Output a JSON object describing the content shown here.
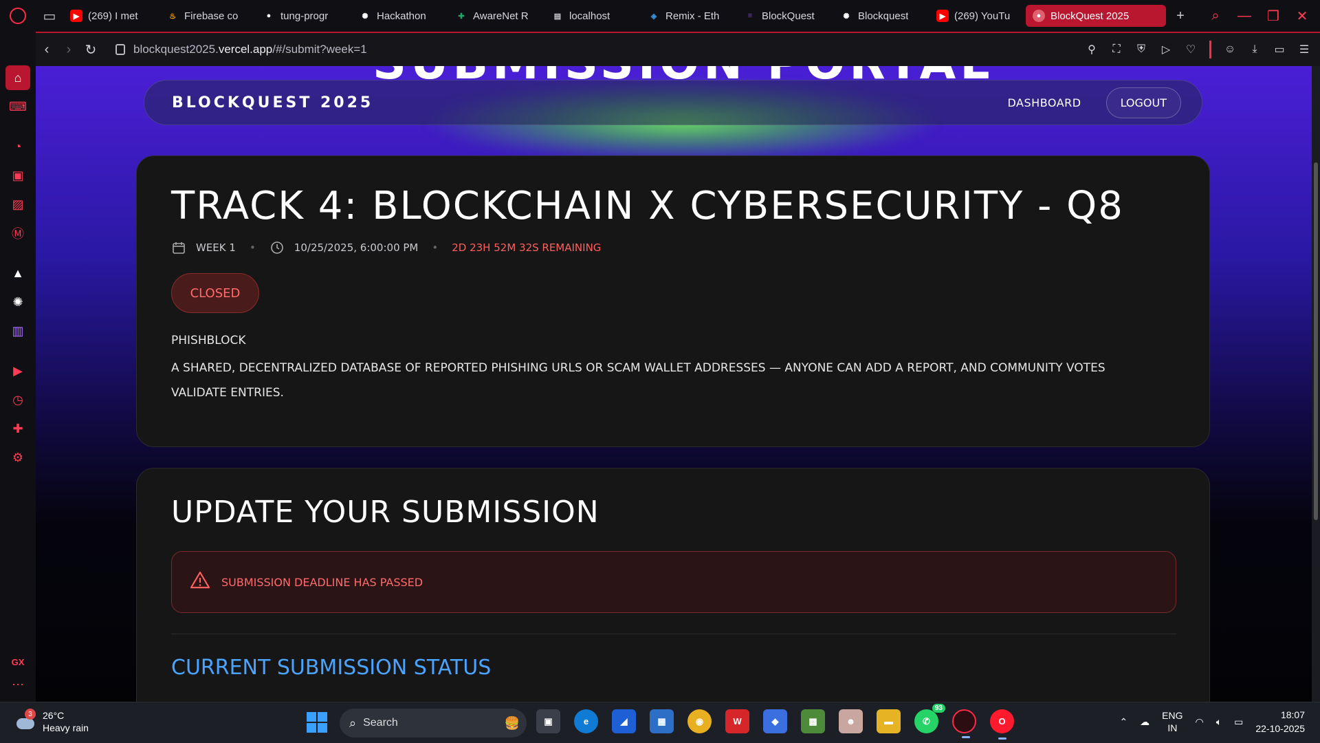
{
  "browser": {
    "tabs": [
      {
        "label": "(269) I met",
        "icon": "youtube-icon",
        "color": "#ff0000"
      },
      {
        "label": "Firebase co",
        "icon": "firebase-icon",
        "color": "#ffa000"
      },
      {
        "label": "tung-progr",
        "icon": "github-icon",
        "color": "#ffffff"
      },
      {
        "label": "Hackathon",
        "icon": "chatgpt-icon",
        "color": "#ffffff"
      },
      {
        "label": "AwareNet R",
        "icon": "sheets-icon",
        "color": "#22a565"
      },
      {
        "label": "localhost",
        "icon": "document-icon",
        "color": "#c8c8d0"
      },
      {
        "label": "Remix - Eth",
        "icon": "remix-icon",
        "color": "#3b8ed4"
      },
      {
        "label": "BlockQuest",
        "icon": "forms-icon",
        "color": "#7248b9"
      },
      {
        "label": "Blockquest",
        "icon": "chatgpt-icon",
        "color": "#ffffff"
      },
      {
        "label": "(269) YouTu",
        "icon": "youtube-icon",
        "color": "#ff0000"
      }
    ],
    "active_tab": {
      "label": "BlockQuest 2025",
      "icon": "site-icon"
    },
    "url_prefix": "blockquest2025.",
    "url_domain": "vercel.app",
    "url_path": "/#/submit?week=1"
  },
  "site": {
    "hero_title": "SUBMISSION PORTAL",
    "brand": "BLOCKQUEST 2025",
    "nav": {
      "dashboard": "DASHBOARD",
      "logout": "LOGOUT"
    }
  },
  "challenge": {
    "title": "TRACK 4: BLOCKCHAIN X CYBERSECURITY - Q8",
    "week": "WEEK 1",
    "deadline": "10/25/2025, 6:00:00 PM",
    "remaining": "2D 23H 52M 32S REMAINING",
    "status": "CLOSED",
    "project_name": "PHISHBLOCK",
    "project_desc": "A shared, decentralized database of reported phishing URLs or scam wallet addresses — anyone can add a report, and community votes validate entries."
  },
  "submission": {
    "title": "UPDATE YOUR SUBMISSION",
    "alert": "SUBMISSION DEADLINE HAS PASSED",
    "status_title": "CURRENT SUBMISSION STATUS"
  },
  "taskbar": {
    "weather_temp": "26°C",
    "weather_desc": "Heavy rain",
    "weather_badge": "3",
    "search_placeholder": "Search",
    "whatsapp_count": "93",
    "lang_top": "ENG",
    "lang_bottom": "IN",
    "time": "18:07",
    "date": "22-10-2025"
  },
  "colors": {
    "accent": "#ff2a47",
    "closed": "#ff6b6b",
    "status_blue": "#4aa3ff"
  }
}
